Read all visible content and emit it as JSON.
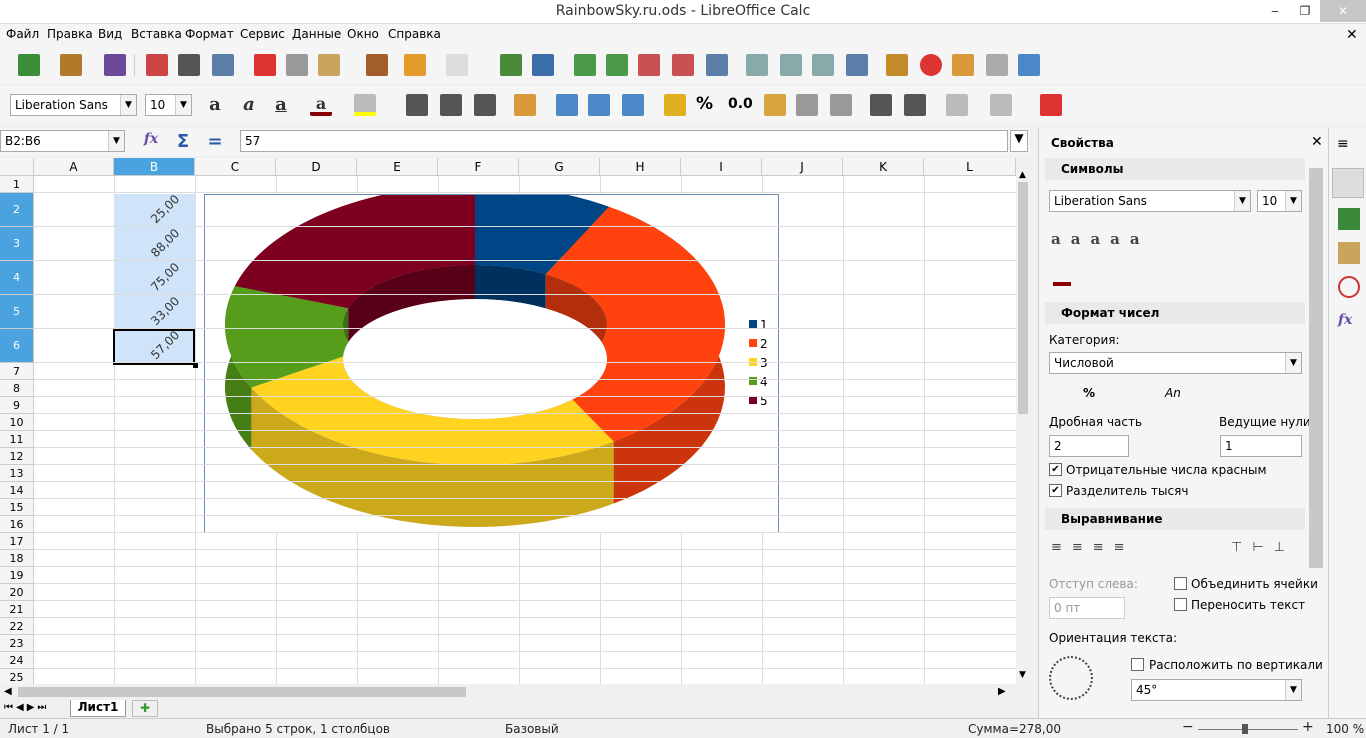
{
  "window": {
    "title": "RainbowSky.ru.ods - LibreOffice Calc",
    "min": "‒",
    "max": "❐",
    "close": "✕"
  },
  "menu": [
    "Файл",
    "Правка",
    "Вид",
    "Вставка",
    "Формат",
    "Сервис",
    "Данные",
    "Окно",
    "Справка"
  ],
  "toolbar": {
    "font_name": "Liberation Sans",
    "font_size": "10",
    "percent": "%",
    "decimal": "0.0"
  },
  "formula": {
    "namebox": "B2:B6",
    "value": "57"
  },
  "columns": [
    "A",
    "B",
    "C",
    "D",
    "E",
    "F",
    "G",
    "H",
    "I",
    "J",
    "K",
    "L"
  ],
  "rows": [
    "1",
    "2",
    "3",
    "4",
    "5",
    "6",
    "7",
    "8",
    "9",
    "10",
    "11",
    "12",
    "13",
    "14",
    "15",
    "16",
    "17",
    "18",
    "19",
    "20",
    "21",
    "22",
    "23",
    "24",
    "25"
  ],
  "cells": {
    "b2": "25,00",
    "b3": "88,00",
    "b4": "75,00",
    "b5": "33,00",
    "b6": "57,00"
  },
  "chart_data": {
    "type": "pie",
    "categories": [
      "1",
      "2",
      "3",
      "4",
      "5"
    ],
    "values": [
      25,
      88,
      75,
      33,
      57
    ],
    "colors": [
      "#004586",
      "#ff420e",
      "#ffd320",
      "#579d1c",
      "#7e0021"
    ],
    "legend": "right",
    "style": "3d-donut"
  },
  "sheet_tabs": {
    "active": "Лист1",
    "add": "✚"
  },
  "status": {
    "sheet": "Лист 1 / 1",
    "selection": "Выбрано 5 строк, 1 столбцов",
    "style": "Базовый",
    "sum": "Сумма=278,00",
    "zoom": "100 %",
    "zoom_minus": "−",
    "zoom_plus": "+"
  },
  "sidebar": {
    "title": "Свойства",
    "close": "✕",
    "symbols": "Символы",
    "font_name": "Liberation Sans",
    "font_size": "10",
    "number_format": "Формат чисел",
    "category_label": "Категория:",
    "category_value": "Числовой",
    "percent": "%",
    "an": "An",
    "decimals_label": "Дробная часть",
    "decimals_value": "2",
    "leading_label": "Ведущие нули:",
    "leading_value": "1",
    "neg_red": "Отрицательные числа красным",
    "thousands": "Разделитель тысяч",
    "alignment": "Выравнивание",
    "indent_label": "Отступ слева:",
    "indent_value": "0 пт",
    "merge": "Объединить ячейки",
    "wrap": "Переносить текст",
    "orientation_label": "Ориентация текста:",
    "vertical": "Расположить по вертикали",
    "angle": "45°"
  }
}
